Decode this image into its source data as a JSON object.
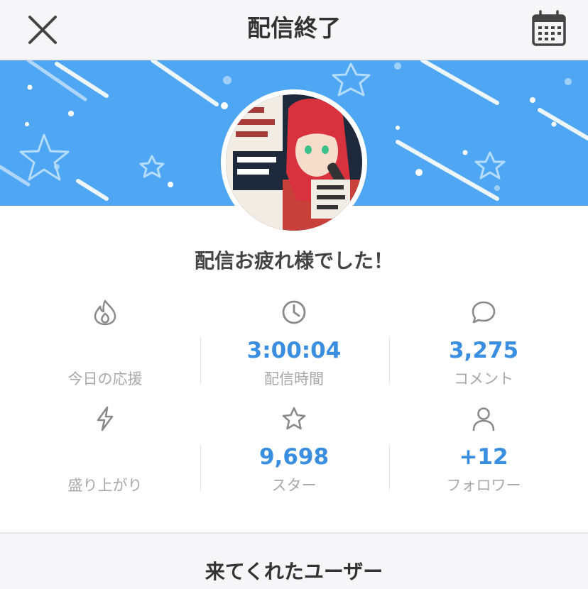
{
  "header": {
    "title": "配信終了",
    "close_icon": "close-icon",
    "calendar_icon": "calendar-icon"
  },
  "banner": {
    "color": "#4fa7f4",
    "avatar_alt": "配信サムネイル"
  },
  "thanks_message": "配信お疲れ様でした！",
  "stats": [
    {
      "icon": "flame-icon",
      "value": "",
      "label": "今日の応援"
    },
    {
      "icon": "clock-icon",
      "value": "3:00:04",
      "label": "配信時間"
    },
    {
      "icon": "comment-icon",
      "value": "3,275",
      "label": "コメント"
    },
    {
      "icon": "lightning-icon",
      "value": "",
      "label": "盛り上がり"
    },
    {
      "icon": "star-icon",
      "value": "9,698",
      "label": "スター"
    },
    {
      "icon": "person-icon",
      "value": "+12",
      "label": "フォロワー"
    }
  ],
  "visitors_section": {
    "title": "来てくれたユーザー"
  },
  "colors": {
    "accent": "#3a8ee0",
    "banner": "#4fa7f4",
    "label": "#a8a8a8"
  }
}
